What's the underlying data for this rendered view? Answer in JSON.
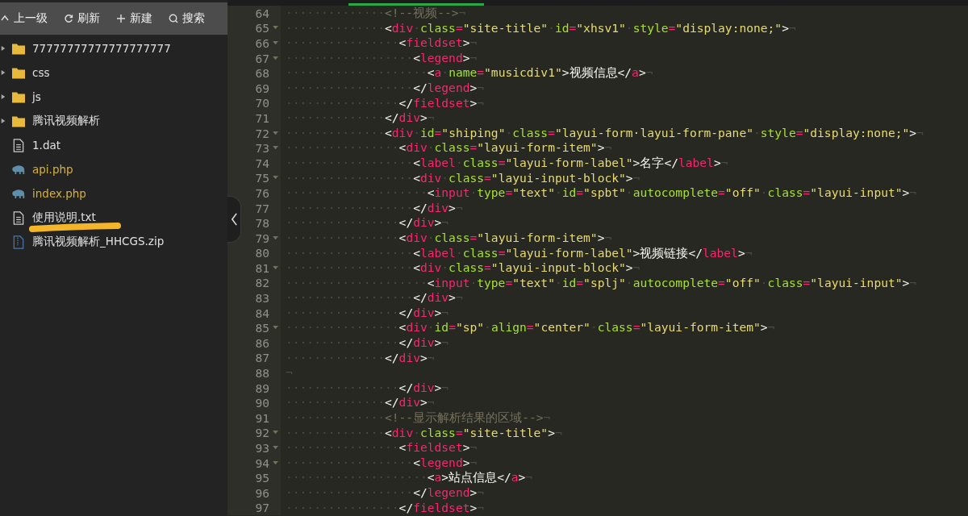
{
  "toolbar": [
    {
      "kind": "up",
      "label": "上一级"
    },
    {
      "kind": "refresh",
      "label": "刷新"
    },
    {
      "kind": "new",
      "label": "新建"
    },
    {
      "kind": "search",
      "label": "搜索"
    }
  ],
  "files": [
    {
      "kind": "folder",
      "name": "77777777777777777777",
      "expanded": false,
      "highlighted": false
    },
    {
      "kind": "folder",
      "name": "css",
      "expanded": false,
      "highlighted": false
    },
    {
      "kind": "folder",
      "name": "js",
      "expanded": false,
      "highlighted": false
    },
    {
      "kind": "folder",
      "name": "腾讯视频解析",
      "expanded": false,
      "highlighted": false
    },
    {
      "kind": "text",
      "name": "1.dat",
      "highlighted": false
    },
    {
      "kind": "php",
      "name": "api.php",
      "highlighted": false
    },
    {
      "kind": "php",
      "name": "index.php",
      "highlighted": false
    },
    {
      "kind": "text",
      "name": "使用说明.txt",
      "highlighted": true
    },
    {
      "kind": "zip",
      "name": "腾讯视频解析_HHCGS.zip",
      "highlighted": false
    }
  ],
  "editor": {
    "lines": [
      {
        "number": "64",
        "foldable": false,
        "tokens": [
          {
            "kind": "ws",
            "text": "··············"
          },
          {
            "kind": "comment",
            "text": "<!--视频-->"
          },
          {
            "kind": "ws",
            "text": "¬"
          }
        ]
      },
      {
        "number": "65",
        "foldable": true,
        "tokens": [
          {
            "kind": "ws",
            "text": "··············"
          },
          {
            "kind": "punct",
            "text": "<"
          },
          {
            "kind": "tag",
            "text": "div"
          },
          {
            "kind": "ws",
            "text": "·"
          },
          {
            "kind": "attr",
            "text": "class"
          },
          {
            "kind": "op",
            "text": "="
          },
          {
            "kind": "string",
            "text": "\"site-title\""
          },
          {
            "kind": "ws",
            "text": "·"
          },
          {
            "kind": "attr",
            "text": "id"
          },
          {
            "kind": "op",
            "text": "="
          },
          {
            "kind": "string",
            "text": "\"xhsv1\""
          },
          {
            "kind": "ws",
            "text": "·"
          },
          {
            "kind": "attr",
            "text": "style"
          },
          {
            "kind": "op",
            "text": "="
          },
          {
            "kind": "string",
            "text": "\"display:none;\""
          },
          {
            "kind": "punct",
            "text": ">"
          },
          {
            "kind": "ws",
            "text": "¬"
          }
        ]
      },
      {
        "number": "66",
        "foldable": true,
        "tokens": [
          {
            "kind": "ws",
            "text": "················"
          },
          {
            "kind": "punct",
            "text": "<"
          },
          {
            "kind": "tag",
            "text": "fieldset"
          },
          {
            "kind": "punct",
            "text": ">"
          },
          {
            "kind": "ws",
            "text": "¬"
          }
        ]
      },
      {
        "number": "67",
        "foldable": true,
        "tokens": [
          {
            "kind": "ws",
            "text": "··················"
          },
          {
            "kind": "punct",
            "text": "<"
          },
          {
            "kind": "tag",
            "text": "legend"
          },
          {
            "kind": "punct",
            "text": ">"
          },
          {
            "kind": "ws",
            "text": "¬"
          }
        ]
      },
      {
        "number": "68",
        "foldable": false,
        "tokens": [
          {
            "kind": "ws",
            "text": "····················"
          },
          {
            "kind": "punct",
            "text": "<"
          },
          {
            "kind": "tag",
            "text": "a"
          },
          {
            "kind": "ws",
            "text": "·"
          },
          {
            "kind": "attr",
            "text": "name"
          },
          {
            "kind": "op",
            "text": "="
          },
          {
            "kind": "string",
            "text": "\"musicdiv1\""
          },
          {
            "kind": "punct",
            "text": ">"
          },
          {
            "kind": "text",
            "text": "视频信息"
          },
          {
            "kind": "punct",
            "text": "</"
          },
          {
            "kind": "tag",
            "text": "a"
          },
          {
            "kind": "punct",
            "text": ">"
          },
          {
            "kind": "ws",
            "text": "¬"
          }
        ]
      },
      {
        "number": "69",
        "foldable": false,
        "tokens": [
          {
            "kind": "ws",
            "text": "··················"
          },
          {
            "kind": "punct",
            "text": "</"
          },
          {
            "kind": "tag",
            "text": "legend"
          },
          {
            "kind": "punct",
            "text": ">"
          },
          {
            "kind": "ws",
            "text": "¬"
          }
        ]
      },
      {
        "number": "70",
        "foldable": false,
        "tokens": [
          {
            "kind": "ws",
            "text": "················"
          },
          {
            "kind": "punct",
            "text": "</"
          },
          {
            "kind": "tag",
            "text": "fieldset"
          },
          {
            "kind": "punct",
            "text": ">"
          },
          {
            "kind": "ws",
            "text": "¬"
          }
        ]
      },
      {
        "number": "71",
        "foldable": false,
        "tokens": [
          {
            "kind": "ws",
            "text": "··············"
          },
          {
            "kind": "punct",
            "text": "</"
          },
          {
            "kind": "tag",
            "text": "div"
          },
          {
            "kind": "punct",
            "text": ">"
          },
          {
            "kind": "ws",
            "text": "¬"
          }
        ]
      },
      {
        "number": "72",
        "foldable": true,
        "tokens": [
          {
            "kind": "ws",
            "text": "··············"
          },
          {
            "kind": "punct",
            "text": "<"
          },
          {
            "kind": "tag",
            "text": "div"
          },
          {
            "kind": "ws",
            "text": "·"
          },
          {
            "kind": "attr",
            "text": "id"
          },
          {
            "kind": "op",
            "text": "="
          },
          {
            "kind": "string",
            "text": "\"shiping\""
          },
          {
            "kind": "ws",
            "text": "·"
          },
          {
            "kind": "attr",
            "text": "class"
          },
          {
            "kind": "op",
            "text": "="
          },
          {
            "kind": "string",
            "text": "\"layui-form·layui-form-pane\""
          },
          {
            "kind": "ws",
            "text": "·"
          },
          {
            "kind": "attr",
            "text": "style"
          },
          {
            "kind": "op",
            "text": "="
          },
          {
            "kind": "string",
            "text": "\"display:none;\""
          },
          {
            "kind": "punct",
            "text": ">"
          },
          {
            "kind": "ws",
            "text": "¬"
          }
        ]
      },
      {
        "number": "73",
        "foldable": true,
        "tokens": [
          {
            "kind": "ws",
            "text": "················"
          },
          {
            "kind": "punct",
            "text": "<"
          },
          {
            "kind": "tag",
            "text": "div"
          },
          {
            "kind": "ws",
            "text": "·"
          },
          {
            "kind": "attr",
            "text": "class"
          },
          {
            "kind": "op",
            "text": "="
          },
          {
            "kind": "string",
            "text": "\"layui-form-item\""
          },
          {
            "kind": "punct",
            "text": ">"
          },
          {
            "kind": "ws",
            "text": "¬"
          }
        ]
      },
      {
        "number": "74",
        "foldable": false,
        "tokens": [
          {
            "kind": "ws",
            "text": "··················"
          },
          {
            "kind": "punct",
            "text": "<"
          },
          {
            "kind": "tag",
            "text": "label"
          },
          {
            "kind": "ws",
            "text": "·"
          },
          {
            "kind": "attr",
            "text": "class"
          },
          {
            "kind": "op",
            "text": "="
          },
          {
            "kind": "string",
            "text": "\"layui-form-label\""
          },
          {
            "kind": "punct",
            "text": ">"
          },
          {
            "kind": "text",
            "text": "名字"
          },
          {
            "kind": "punct",
            "text": "</"
          },
          {
            "kind": "tag",
            "text": "label"
          },
          {
            "kind": "punct",
            "text": ">"
          },
          {
            "kind": "ws",
            "text": "¬"
          }
        ]
      },
      {
        "number": "75",
        "foldable": true,
        "tokens": [
          {
            "kind": "ws",
            "text": "··················"
          },
          {
            "kind": "punct",
            "text": "<"
          },
          {
            "kind": "tag",
            "text": "div"
          },
          {
            "kind": "ws",
            "text": "·"
          },
          {
            "kind": "attr",
            "text": "class"
          },
          {
            "kind": "op",
            "text": "="
          },
          {
            "kind": "string",
            "text": "\"layui-input-block\""
          },
          {
            "kind": "punct",
            "text": ">"
          },
          {
            "kind": "ws",
            "text": "¬"
          }
        ]
      },
      {
        "number": "76",
        "foldable": false,
        "tokens": [
          {
            "kind": "ws",
            "text": "····················"
          },
          {
            "kind": "punct",
            "text": "<"
          },
          {
            "kind": "tag",
            "text": "input"
          },
          {
            "kind": "ws",
            "text": "·"
          },
          {
            "kind": "attr",
            "text": "type"
          },
          {
            "kind": "op",
            "text": "="
          },
          {
            "kind": "string",
            "text": "\"text\""
          },
          {
            "kind": "ws",
            "text": "·"
          },
          {
            "kind": "attr",
            "text": "id"
          },
          {
            "kind": "op",
            "text": "="
          },
          {
            "kind": "string",
            "text": "\"spbt\""
          },
          {
            "kind": "ws",
            "text": "·"
          },
          {
            "kind": "attr",
            "text": "autocomplete"
          },
          {
            "kind": "op",
            "text": "="
          },
          {
            "kind": "string",
            "text": "\"off\""
          },
          {
            "kind": "ws",
            "text": "·"
          },
          {
            "kind": "attr",
            "text": "class"
          },
          {
            "kind": "op",
            "text": "="
          },
          {
            "kind": "string",
            "text": "\"layui-input\""
          },
          {
            "kind": "punct",
            "text": ">"
          },
          {
            "kind": "ws",
            "text": "¬"
          }
        ]
      },
      {
        "number": "77",
        "foldable": false,
        "tokens": [
          {
            "kind": "ws",
            "text": "··················"
          },
          {
            "kind": "punct",
            "text": "</"
          },
          {
            "kind": "tag",
            "text": "div"
          },
          {
            "kind": "punct",
            "text": ">"
          },
          {
            "kind": "ws",
            "text": "¬"
          }
        ]
      },
      {
        "number": "78",
        "foldable": false,
        "tokens": [
          {
            "kind": "ws",
            "text": "················"
          },
          {
            "kind": "punct",
            "text": "</"
          },
          {
            "kind": "tag",
            "text": "div"
          },
          {
            "kind": "punct",
            "text": ">"
          },
          {
            "kind": "ws",
            "text": "¬"
          }
        ]
      },
      {
        "number": "79",
        "foldable": true,
        "tokens": [
          {
            "kind": "ws",
            "text": "················"
          },
          {
            "kind": "punct",
            "text": "<"
          },
          {
            "kind": "tag",
            "text": "div"
          },
          {
            "kind": "ws",
            "text": "·"
          },
          {
            "kind": "attr",
            "text": "class"
          },
          {
            "kind": "op",
            "text": "="
          },
          {
            "kind": "string",
            "text": "\"layui-form-item\""
          },
          {
            "kind": "punct",
            "text": ">"
          },
          {
            "kind": "ws",
            "text": "¬"
          }
        ]
      },
      {
        "number": "80",
        "foldable": false,
        "tokens": [
          {
            "kind": "ws",
            "text": "··················"
          },
          {
            "kind": "punct",
            "text": "<"
          },
          {
            "kind": "tag",
            "text": "label"
          },
          {
            "kind": "ws",
            "text": "·"
          },
          {
            "kind": "attr",
            "text": "class"
          },
          {
            "kind": "op",
            "text": "="
          },
          {
            "kind": "string",
            "text": "\"layui-form-label\""
          },
          {
            "kind": "punct",
            "text": ">"
          },
          {
            "kind": "text",
            "text": "视频链接"
          },
          {
            "kind": "punct",
            "text": "</"
          },
          {
            "kind": "tag",
            "text": "label"
          },
          {
            "kind": "punct",
            "text": ">"
          },
          {
            "kind": "ws",
            "text": "¬"
          }
        ]
      },
      {
        "number": "81",
        "foldable": true,
        "tokens": [
          {
            "kind": "ws",
            "text": "··················"
          },
          {
            "kind": "punct",
            "text": "<"
          },
          {
            "kind": "tag",
            "text": "div"
          },
          {
            "kind": "ws",
            "text": "·"
          },
          {
            "kind": "attr",
            "text": "class"
          },
          {
            "kind": "op",
            "text": "="
          },
          {
            "kind": "string",
            "text": "\"layui-input-block\""
          },
          {
            "kind": "punct",
            "text": ">"
          },
          {
            "kind": "ws",
            "text": "¬"
          }
        ]
      },
      {
        "number": "82",
        "foldable": false,
        "tokens": [
          {
            "kind": "ws",
            "text": "····················"
          },
          {
            "kind": "punct",
            "text": "<"
          },
          {
            "kind": "tag",
            "text": "input"
          },
          {
            "kind": "ws",
            "text": "·"
          },
          {
            "kind": "attr",
            "text": "type"
          },
          {
            "kind": "op",
            "text": "="
          },
          {
            "kind": "string",
            "text": "\"text\""
          },
          {
            "kind": "ws",
            "text": "·"
          },
          {
            "kind": "attr",
            "text": "id"
          },
          {
            "kind": "op",
            "text": "="
          },
          {
            "kind": "string",
            "text": "\"splj\""
          },
          {
            "kind": "ws",
            "text": "·"
          },
          {
            "kind": "attr",
            "text": "autocomplete"
          },
          {
            "kind": "op",
            "text": "="
          },
          {
            "kind": "string",
            "text": "\"off\""
          },
          {
            "kind": "ws",
            "text": "·"
          },
          {
            "kind": "attr",
            "text": "class"
          },
          {
            "kind": "op",
            "text": "="
          },
          {
            "kind": "string",
            "text": "\"layui-input\""
          },
          {
            "kind": "punct",
            "text": ">"
          },
          {
            "kind": "ws",
            "text": "¬"
          }
        ]
      },
      {
        "number": "83",
        "foldable": false,
        "tokens": [
          {
            "kind": "ws",
            "text": "··················"
          },
          {
            "kind": "punct",
            "text": "</"
          },
          {
            "kind": "tag",
            "text": "div"
          },
          {
            "kind": "punct",
            "text": ">"
          },
          {
            "kind": "ws",
            "text": "¬"
          }
        ]
      },
      {
        "number": "84",
        "foldable": false,
        "tokens": [
          {
            "kind": "ws",
            "text": "················"
          },
          {
            "kind": "punct",
            "text": "</"
          },
          {
            "kind": "tag",
            "text": "div"
          },
          {
            "kind": "punct",
            "text": ">"
          },
          {
            "kind": "ws",
            "text": "¬"
          }
        ]
      },
      {
        "number": "85",
        "foldable": true,
        "tokens": [
          {
            "kind": "ws",
            "text": "················"
          },
          {
            "kind": "punct",
            "text": "<"
          },
          {
            "kind": "tag",
            "text": "div"
          },
          {
            "kind": "ws",
            "text": "·"
          },
          {
            "kind": "attr",
            "text": "id"
          },
          {
            "kind": "op",
            "text": "="
          },
          {
            "kind": "string",
            "text": "\"sp\""
          },
          {
            "kind": "ws",
            "text": "·"
          },
          {
            "kind": "attr",
            "text": "align"
          },
          {
            "kind": "op",
            "text": "="
          },
          {
            "kind": "string",
            "text": "\"center\""
          },
          {
            "kind": "ws",
            "text": "·"
          },
          {
            "kind": "attr",
            "text": "class"
          },
          {
            "kind": "op",
            "text": "="
          },
          {
            "kind": "string",
            "text": "\"layui-form-item\""
          },
          {
            "kind": "punct",
            "text": ">"
          },
          {
            "kind": "ws",
            "text": "¬"
          }
        ]
      },
      {
        "number": "86",
        "foldable": false,
        "tokens": [
          {
            "kind": "ws",
            "text": "················"
          },
          {
            "kind": "punct",
            "text": "</"
          },
          {
            "kind": "tag",
            "text": "div"
          },
          {
            "kind": "punct",
            "text": ">"
          },
          {
            "kind": "ws",
            "text": "¬"
          }
        ]
      },
      {
        "number": "87",
        "foldable": false,
        "tokens": [
          {
            "kind": "ws",
            "text": "··············"
          },
          {
            "kind": "punct",
            "text": "</"
          },
          {
            "kind": "tag",
            "text": "div"
          },
          {
            "kind": "punct",
            "text": ">"
          },
          {
            "kind": "ws",
            "text": "¬"
          }
        ]
      },
      {
        "number": "88",
        "foldable": false,
        "tokens": [
          {
            "kind": "ws",
            "text": "¬"
          }
        ]
      },
      {
        "number": "89",
        "foldable": false,
        "tokens": [
          {
            "kind": "ws",
            "text": "················"
          },
          {
            "kind": "punct",
            "text": "</"
          },
          {
            "kind": "tag",
            "text": "div"
          },
          {
            "kind": "punct",
            "text": ">"
          },
          {
            "kind": "ws",
            "text": "¬"
          }
        ]
      },
      {
        "number": "90",
        "foldable": false,
        "tokens": [
          {
            "kind": "ws",
            "text": "··············"
          },
          {
            "kind": "punct",
            "text": "</"
          },
          {
            "kind": "tag",
            "text": "div"
          },
          {
            "kind": "punct",
            "text": ">"
          },
          {
            "kind": "ws",
            "text": "¬"
          }
        ]
      },
      {
        "number": "91",
        "foldable": false,
        "tokens": [
          {
            "kind": "ws",
            "text": "··············"
          },
          {
            "kind": "comment",
            "text": "<!--显示解析结果的区域-->"
          },
          {
            "kind": "ws",
            "text": "¬"
          }
        ]
      },
      {
        "number": "92",
        "foldable": true,
        "tokens": [
          {
            "kind": "ws",
            "text": "··············"
          },
          {
            "kind": "punct",
            "text": "<"
          },
          {
            "kind": "tag",
            "text": "div"
          },
          {
            "kind": "ws",
            "text": "·"
          },
          {
            "kind": "attr",
            "text": "class"
          },
          {
            "kind": "op",
            "text": "="
          },
          {
            "kind": "string",
            "text": "\"site-title\""
          },
          {
            "kind": "punct",
            "text": ">"
          },
          {
            "kind": "ws",
            "text": "¬"
          }
        ]
      },
      {
        "number": "93",
        "foldable": true,
        "tokens": [
          {
            "kind": "ws",
            "text": "················"
          },
          {
            "kind": "punct",
            "text": "<"
          },
          {
            "kind": "tag",
            "text": "fieldset"
          },
          {
            "kind": "punct",
            "text": ">"
          },
          {
            "kind": "ws",
            "text": "¬"
          }
        ]
      },
      {
        "number": "94",
        "foldable": true,
        "tokens": [
          {
            "kind": "ws",
            "text": "··················"
          },
          {
            "kind": "punct",
            "text": "<"
          },
          {
            "kind": "tag",
            "text": "legend"
          },
          {
            "kind": "punct",
            "text": ">"
          },
          {
            "kind": "ws",
            "text": "¬"
          }
        ]
      },
      {
        "number": "95",
        "foldable": false,
        "tokens": [
          {
            "kind": "ws",
            "text": "····················"
          },
          {
            "kind": "punct",
            "text": "<"
          },
          {
            "kind": "tag",
            "text": "a"
          },
          {
            "kind": "punct",
            "text": ">"
          },
          {
            "kind": "text",
            "text": "站点信息"
          },
          {
            "kind": "punct",
            "text": "</"
          },
          {
            "kind": "tag",
            "text": "a"
          },
          {
            "kind": "punct",
            "text": ">"
          },
          {
            "kind": "ws",
            "text": "¬"
          }
        ]
      },
      {
        "number": "96",
        "foldable": false,
        "tokens": [
          {
            "kind": "ws",
            "text": "··················"
          },
          {
            "kind": "punct",
            "text": "</"
          },
          {
            "kind": "tag",
            "text": "legend"
          },
          {
            "kind": "punct",
            "text": ">"
          },
          {
            "kind": "ws",
            "text": "¬"
          }
        ]
      },
      {
        "number": "97",
        "foldable": false,
        "tokens": [
          {
            "kind": "ws",
            "text": "················"
          },
          {
            "kind": "punct",
            "text": "</"
          },
          {
            "kind": "tag",
            "text": "fieldset"
          },
          {
            "kind": "punct",
            "text": ">"
          },
          {
            "kind": "ws",
            "text": "¬"
          }
        ]
      }
    ]
  }
}
